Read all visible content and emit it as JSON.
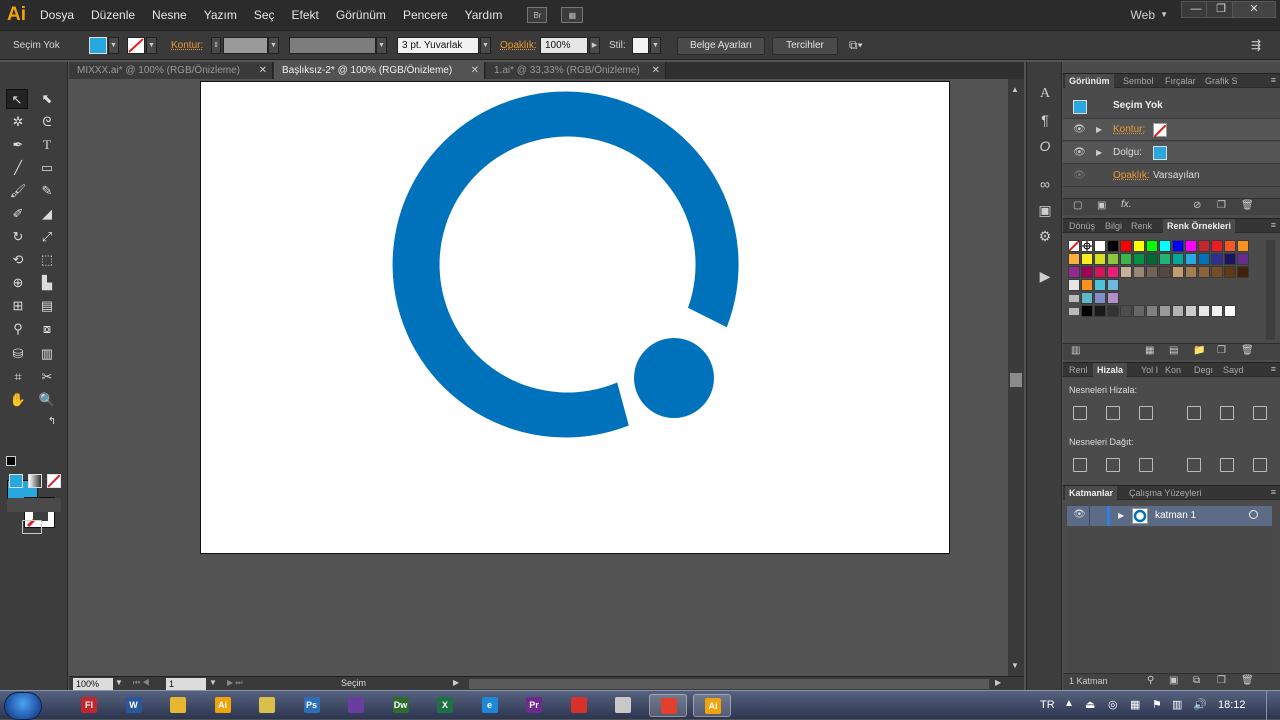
{
  "app": {
    "logo": "Ai",
    "workspace": "Web"
  },
  "menu": [
    "Dosya",
    "Düzenle",
    "Nesne",
    "Yazım",
    "Seç",
    "Efekt",
    "Görünüm",
    "Pencere",
    "Yardım"
  ],
  "menu_icons": {
    "bridge": "Br"
  },
  "window_controls": {
    "minimize": "—",
    "maximize": "❐",
    "close": "✕"
  },
  "control_bar": {
    "selection_status": "Seçim Yok",
    "stroke_label": "Kontur:",
    "brush_value": "3 pt. Yuvarlak",
    "opacity_label": "Opaklık:",
    "opacity_value": "100%",
    "style_label": "Stil:",
    "document_setup": "Belge Ayarları",
    "preferences": "Tercihler"
  },
  "tabs": [
    {
      "label": "MIXXX.ai* @ 100% (RGB/Önizleme)",
      "active": false
    },
    {
      "label": "Başlıksız-2* @ 100% (RGB/Önizleme)",
      "active": true
    },
    {
      "label": "1.ai* @ 33,33% (RGB/Önizleme)",
      "active": false
    }
  ],
  "artwork": {
    "ring_color": "#0072bc"
  },
  "status_bar": {
    "zoom": "100%",
    "artboard_number": "1",
    "tool": "Seçim"
  },
  "appearance_panel": {
    "tabs": [
      "Görünüm",
      "Sembol",
      "Fırçalar",
      "Grafik S"
    ],
    "title": "Seçim Yok",
    "stroke_label": "Kontur:",
    "fill_label": "Dolgu:",
    "opacity_label": "Opaklık:",
    "opacity_value": "Varsayılan"
  },
  "swatches_panel": {
    "tabs": [
      "Dönüş",
      "Bilgi",
      "Renk",
      "Renk Örnekleri"
    ]
  },
  "align_panel": {
    "tabs": [
      "Renl",
      "Hizala",
      "Yol I",
      "Kon",
      "Degı",
      "Sayd"
    ],
    "align_objects": "Nesneleri Hizala:",
    "distribute_objects": "Nesneleri Dağıt:"
  },
  "layers_panel": {
    "tabs": [
      "Katmanlar",
      "Çalışma Yüzeyleri"
    ],
    "layer_name": "katman 1",
    "layer_count": "1 Katman"
  },
  "taskbar": {
    "lang": "TR",
    "time": "18:12",
    "apps": [
      {
        "label": "Fl",
        "color": "#c0262c"
      },
      {
        "label": "W",
        "color": "#2b579a"
      },
      {
        "label": "",
        "color": "#e8b730"
      },
      {
        "label": "Ai",
        "color": "#f0a30a"
      },
      {
        "label": "",
        "color": "#d8c04a"
      },
      {
        "label": "Ps",
        "color": "#2b6fb8"
      },
      {
        "label": "",
        "color": "#6a3ea1"
      },
      {
        "label": "Dw",
        "color": "#2f6a2f"
      },
      {
        "label": "X",
        "color": "#1d7144"
      },
      {
        "label": "e",
        "color": "#1e88d8"
      },
      {
        "label": "Pr",
        "color": "#6b2a8c"
      },
      {
        "label": "",
        "color": "#d8312b"
      },
      {
        "label": "",
        "color": "#c9c9c9"
      },
      {
        "label": "",
        "color": "#e0402c"
      },
      {
        "label": "Ai",
        "color": "#f0a30a"
      }
    ]
  }
}
